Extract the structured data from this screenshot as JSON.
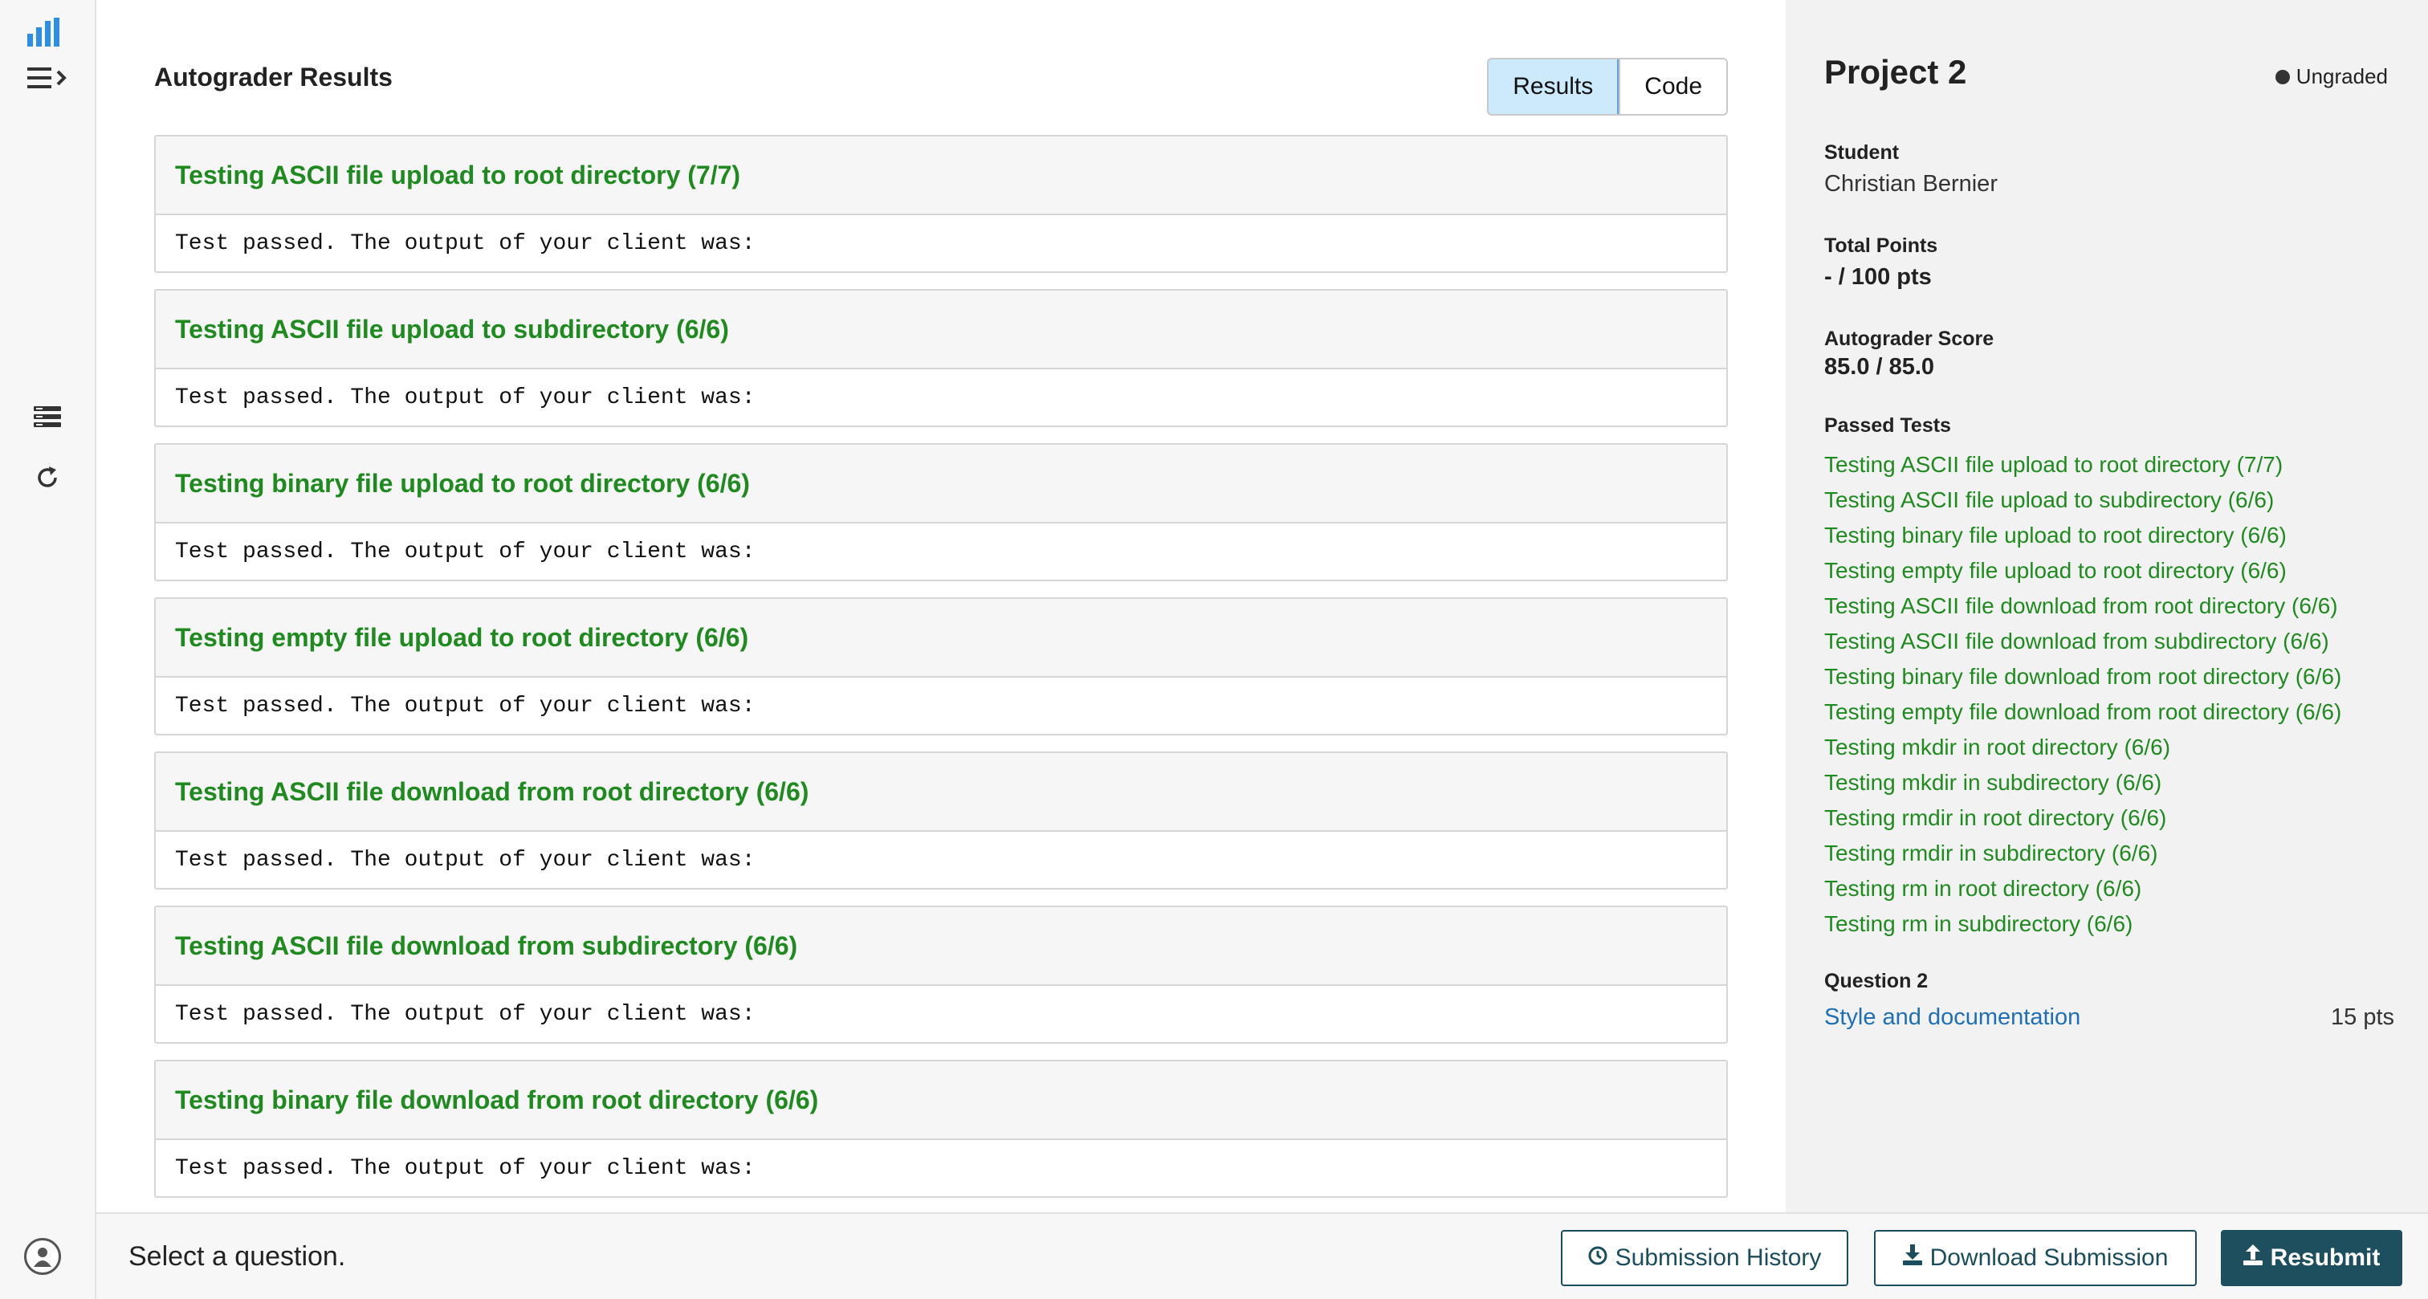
{
  "main": {
    "heading": "Autograder Results",
    "view_tabs": [
      {
        "label": "Results",
        "active": true
      },
      {
        "label": "Code",
        "active": false
      }
    ],
    "tests": [
      {
        "title": "Testing ASCII file upload to root directory (7/7)",
        "output": "Test passed. The output of your client was:"
      },
      {
        "title": "Testing ASCII file upload to subdirectory (6/6)",
        "output": "Test passed. The output of your client was:"
      },
      {
        "title": "Testing binary file upload to root directory (6/6)",
        "output": "Test passed. The output of your client was:"
      },
      {
        "title": "Testing empty file upload to root directory (6/6)",
        "output": "Test passed. The output of your client was:"
      },
      {
        "title": "Testing ASCII file download from root directory (6/6)",
        "output": "Test passed. The output of your client was:"
      },
      {
        "title": "Testing ASCII file download from subdirectory (6/6)",
        "output": "Test passed. The output of your client was:"
      },
      {
        "title": "Testing binary file download from root directory (6/6)",
        "output": "Test passed. The output of your client was:"
      }
    ]
  },
  "side": {
    "title": "Project 2",
    "status": "Ungraded",
    "student_label": "Student",
    "student_name": "Christian Bernier",
    "total_points_label": "Total Points",
    "total_points": "- / 100 pts",
    "autograder_label": "Autograder Score",
    "autograder_score": "85.0 / 85.0",
    "passed_label": "Passed Tests",
    "passed_tests": [
      "Testing ASCII file upload to root directory (7/7)",
      "Testing ASCII file upload to subdirectory (6/6)",
      "Testing binary file upload to root directory (6/6)",
      "Testing empty file upload to root directory (6/6)",
      "Testing ASCII file download from root directory (6/6)",
      "Testing ASCII file download from subdirectory (6/6)",
      "Testing binary file download from root directory (6/6)",
      "Testing empty file download from root directory (6/6)",
      "Testing mkdir in root directory (6/6)",
      "Testing mkdir in subdirectory (6/6)",
      "Testing rmdir in root directory (6/6)",
      "Testing rmdir in subdirectory (6/6)",
      "Testing rm in root directory (6/6)",
      "Testing rm in subdirectory (6/6)"
    ],
    "question_label": "Question 2",
    "question_link": "Style and documentation",
    "question_points": "15 pts"
  },
  "bottombar": {
    "hint": "Select a question.",
    "history_label": "Submission History",
    "download_label": "Download Submission",
    "resubmit_label": "Resubmit"
  },
  "icons": {
    "logo": "bar-chart-icon",
    "menu": "menu-expand-icon",
    "outline": "outline-list-icon",
    "rerun": "refresh-icon",
    "avatar": "user-avatar-icon",
    "history": "clock-icon",
    "download": "download-icon",
    "resubmit": "upload-icon"
  },
  "colors": {
    "pass_green": "#1f8a1f",
    "link_blue": "#1f6fb4",
    "primary_teal": "#1d4f5e",
    "active_tab": "#cdeafc",
    "logo_blue": "#2d8ee6"
  }
}
